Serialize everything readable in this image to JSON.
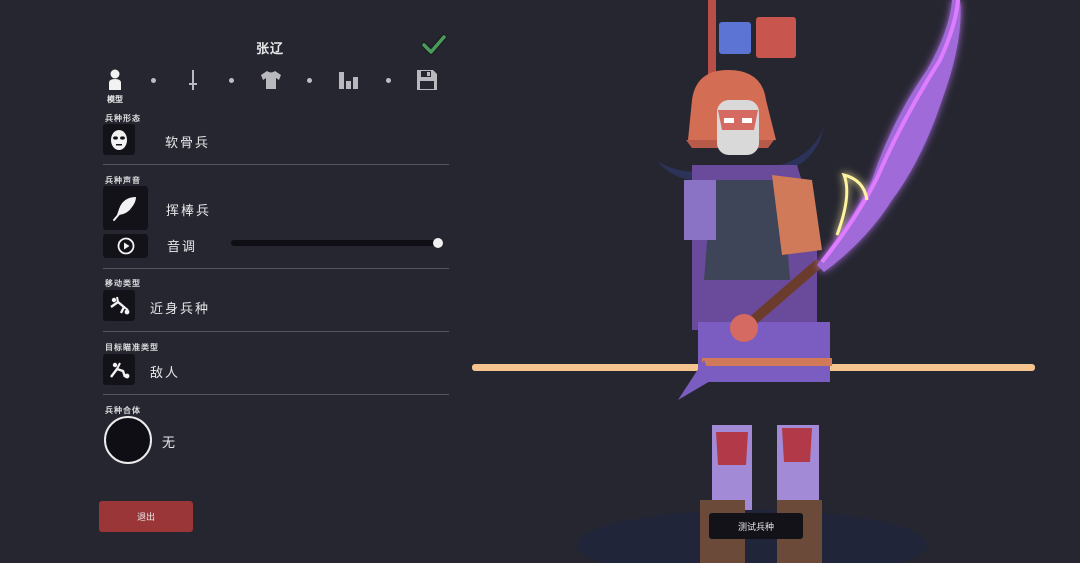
{
  "header": {
    "title": "张辽"
  },
  "tabs": [
    {
      "name": "model",
      "label": "模型",
      "icon": "person-icon"
    },
    {
      "name": "weapon",
      "icon": "sword-icon"
    },
    {
      "name": "clothing",
      "icon": "shirt-icon"
    },
    {
      "name": "stats",
      "icon": "bar-chart-icon"
    },
    {
      "name": "save",
      "icon": "floppy-disk-icon"
    }
  ],
  "sections": {
    "form": {
      "label": "兵种形态",
      "value": "软骨兵",
      "icon": "mask-face-icon"
    },
    "voice": {
      "label": "兵种声音",
      "value": "挥棒兵",
      "icon": "feather-icon",
      "pitch_label": "音调",
      "pitch_value": 1.0
    },
    "movement": {
      "label": "移动类型",
      "value": "近身兵种",
      "icon": "running-unit-icon"
    },
    "targeting": {
      "label": "目标瞄准类型",
      "value": "敌人",
      "icon": "target-unit-icon"
    },
    "combine": {
      "label": "兵种合体",
      "value": "无"
    }
  },
  "buttons": {
    "exit": "退出",
    "test": "测试兵种"
  },
  "colors": {
    "background": "#262630",
    "team_blue": "#5c74d3",
    "team_red": "#c9554f",
    "exit_button": "#9a3538",
    "confirm_check": "#4a9a5c",
    "glaive_glow": "#e07bff"
  }
}
